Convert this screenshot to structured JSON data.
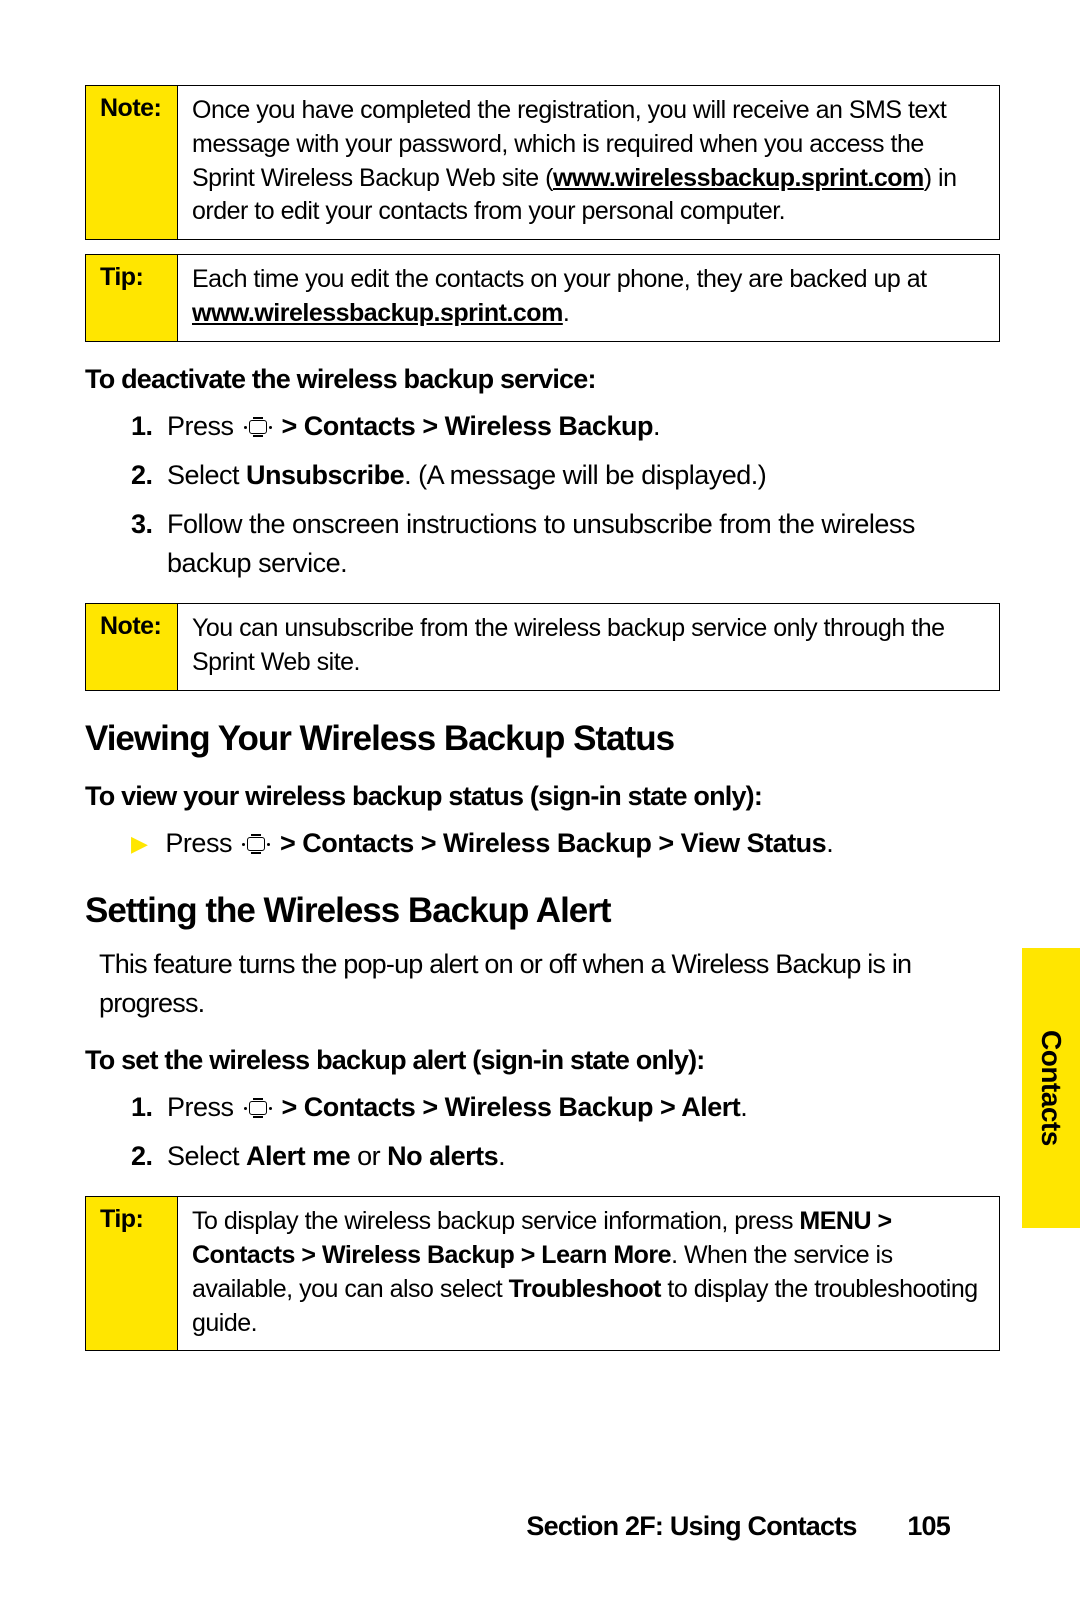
{
  "callouts": {
    "note1": {
      "label": "Note:",
      "pre": "Once you have completed the registration, you will receive an SMS text message with your password, which is  required when you access the Sprint Wireless Backup Web site (",
      "link": "www.wirelessbackup.sprint.com",
      "post": ") in order to edit your contacts from your personal computer."
    },
    "tip1": {
      "label": "Tip:",
      "pre": "Each time you edit the contacts on your phone, they are backed up at ",
      "link": "www.wirelessbackup.sprint.com",
      "post": "."
    },
    "note2": {
      "label": "Note:",
      "text": "You can unsubscribe from the wireless backup service only through the Sprint Web site."
    },
    "tip2": {
      "label": "Tip:",
      "p1": "To display the wireless backup service information, press ",
      "b1": "MENU > Contacts > Wireless Backup > Learn More",
      "p2": ". When the service is available, you can also select ",
      "b2": "Troubleshoot",
      "p3": " to display the troubleshooting guide."
    }
  },
  "deactivate": {
    "heading": "To deactivate the wireless backup service:",
    "steps": [
      {
        "num": "1.",
        "pre": "Press ",
        "bold": " > Contacts > Wireless Backup",
        "post": "."
      },
      {
        "num": "2.",
        "pre": "Select ",
        "bold": "Unsubscribe",
        "post": ". (A message will be displayed.)"
      },
      {
        "num": "3.",
        "text": "Follow the onscreen instructions to unsubscribe from the wireless backup service."
      }
    ]
  },
  "viewing": {
    "title": "Viewing Your Wireless Backup Status",
    "sub": "To view your wireless backup status (sign-in state only):",
    "step_pre": "Press ",
    "step_bold": " > Contacts > Wireless Backup > View Status",
    "step_post": "."
  },
  "setting": {
    "title": "Setting the Wireless Backup Alert",
    "para": "This feature turns the pop-up alert on or off when a Wireless Backup is in progress.",
    "sub": "To set the wireless backup alert (sign-in state only):",
    "steps": [
      {
        "num": "1.",
        "pre": "Press ",
        "bold": " > Contacts > Wireless Backup > Alert",
        "post": "."
      },
      {
        "num": "2.",
        "pre": "Select ",
        "bold1": "Alert me",
        "mid": " or ",
        "bold2": "No alerts",
        "post": "."
      }
    ]
  },
  "sidetab": "Contacts",
  "footer": {
    "section": "Section 2F: Using Contacts",
    "page": "105"
  }
}
